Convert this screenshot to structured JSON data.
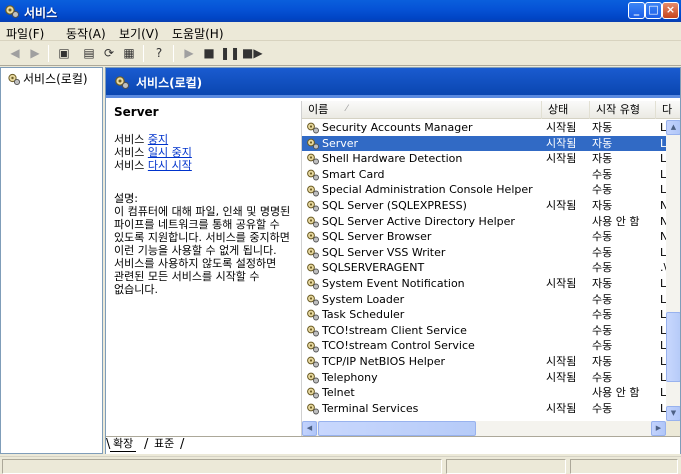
{
  "window": {
    "title": "서비스"
  },
  "menu": [
    "파일(F)",
    "동작(A)",
    "보기(V)",
    "도움말(H)"
  ],
  "tree": {
    "root": "서비스(로컬)"
  },
  "header": {
    "title": "서비스(로컬)"
  },
  "description": {
    "service_name": "Server",
    "actions": [
      {
        "prefix": "서비스 ",
        "link": "중지"
      },
      {
        "prefix": "서비스 ",
        "link": "일시 중지"
      },
      {
        "prefix": "서비스 ",
        "link": "다시 시작"
      }
    ],
    "label": "설명:",
    "body": "이 컴퓨터에 대해 파일, 인쇄 및 명명된 파이프를 네트워크를 통해 공유할 수 있도록 지원합니다. 서비스를 중지하면 이런 기능을 사용할 수 없게 됩니다. 서비스를 사용하지 않도록 설정하면 관련된 모든 서비스를 시작할 수 없습니다."
  },
  "columns": {
    "name": "이름",
    "status": "상태",
    "startup": "시작 유형",
    "logon": "다"
  },
  "rows": [
    {
      "name": "Security Accounts Manager",
      "status": "시작됨",
      "startup": "자동",
      "logon": "Lo"
    },
    {
      "name": "Server",
      "status": "시작됨",
      "startup": "자동",
      "logon": "Lo",
      "selected": true
    },
    {
      "name": "Shell Hardware Detection",
      "status": "시작됨",
      "startup": "자동",
      "logon": "Lo"
    },
    {
      "name": "Smart Card",
      "status": "",
      "startup": "수동",
      "logon": "Lo"
    },
    {
      "name": "Special Administration Console Helper",
      "status": "",
      "startup": "수동",
      "logon": "Lo"
    },
    {
      "name": "SQL Server (SQLEXPRESS)",
      "status": "시작됨",
      "startup": "자동",
      "logon": "N"
    },
    {
      "name": "SQL Server Active Directory Helper",
      "status": "",
      "startup": "사용 안 함",
      "logon": "N"
    },
    {
      "name": "SQL Server Browser",
      "status": "",
      "startup": "수동",
      "logon": "N"
    },
    {
      "name": "SQL Server VSS Writer",
      "status": "",
      "startup": "수동",
      "logon": "Lo"
    },
    {
      "name": "SQLSERVERAGENT",
      "status": "",
      "startup": "수동",
      "logon": ".\\"
    },
    {
      "name": "System Event Notification",
      "status": "시작됨",
      "startup": "자동",
      "logon": "Lo"
    },
    {
      "name": "System Loader",
      "status": "",
      "startup": "수동",
      "logon": "Lo"
    },
    {
      "name": "Task Scheduler",
      "status": "",
      "startup": "수동",
      "logon": "Lo"
    },
    {
      "name": "TCO!stream Client Service",
      "status": "",
      "startup": "수동",
      "logon": "Lo"
    },
    {
      "name": "TCO!stream Control Service",
      "status": "",
      "startup": "수동",
      "logon": "Lo"
    },
    {
      "name": "TCP/IP NetBIOS Helper",
      "status": "시작됨",
      "startup": "자동",
      "logon": "Lo"
    },
    {
      "name": "Telephony",
      "status": "시작됨",
      "startup": "수동",
      "logon": "Lo"
    },
    {
      "name": "Telnet",
      "status": "",
      "startup": "사용 안 함",
      "logon": "Lo"
    },
    {
      "name": "Terminal Services",
      "status": "시작됨",
      "startup": "수동",
      "logon": "Lo"
    }
  ],
  "tabs": [
    "확장",
    "표준"
  ],
  "colors": {
    "title_bar": "#0653d6",
    "selection": "#316ac5",
    "header": "#0a46b0",
    "link": "#0033cc"
  }
}
